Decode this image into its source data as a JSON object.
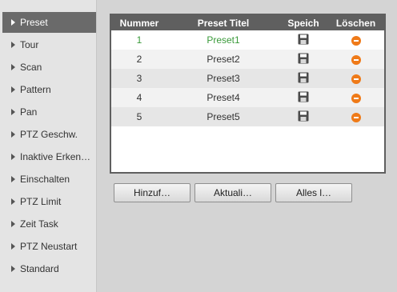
{
  "sidebar": {
    "items": [
      {
        "label": "Preset"
      },
      {
        "label": "Tour"
      },
      {
        "label": "Scan"
      },
      {
        "label": "Pattern"
      },
      {
        "label": "Pan"
      },
      {
        "label": "PTZ Geschw."
      },
      {
        "label": "Inaktive Erken…"
      },
      {
        "label": "Einschalten"
      },
      {
        "label": "PTZ Limit"
      },
      {
        "label": "Zeit Task"
      },
      {
        "label": "PTZ Neustart"
      },
      {
        "label": "Standard"
      }
    ]
  },
  "table": {
    "headers": {
      "number": "Nummer",
      "title": "Preset Titel",
      "save": "Speich",
      "delete": "Löschen"
    },
    "rows": [
      {
        "number": "1",
        "title": "Preset1"
      },
      {
        "number": "2",
        "title": "Preset2"
      },
      {
        "number": "3",
        "title": "Preset3"
      },
      {
        "number": "4",
        "title": "Preset4"
      },
      {
        "number": "5",
        "title": "Preset5"
      }
    ],
    "save_icon": "floppy-disk-icon",
    "delete_icon": "minus-circle-icon",
    "delete_color": "#ef7a18",
    "selected_color": "#3a9a3a"
  },
  "buttons": {
    "add": "Hinzuf…",
    "refresh": "Aktuali…",
    "delete_all": "Alles l…"
  }
}
